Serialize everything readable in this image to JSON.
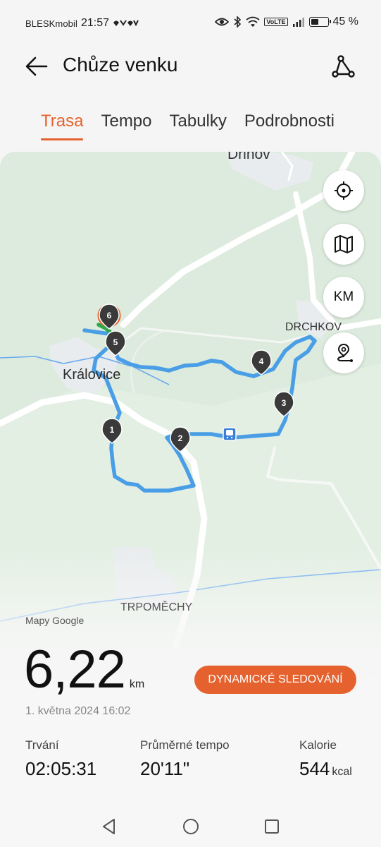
{
  "status": {
    "carrier": "BLESKmobil",
    "time": "21:57",
    "volte": "VoLTE",
    "battery": "45 %"
  },
  "header": {
    "title": "Chůze venku"
  },
  "tabs": [
    {
      "label": "Trasa",
      "active": true
    },
    {
      "label": "Tempo",
      "active": false
    },
    {
      "label": "Tabulky",
      "active": false
    },
    {
      "label": "Podrobnosti",
      "active": false
    }
  ],
  "map": {
    "places": {
      "drinov": "Drinov",
      "kralovice": "Královice",
      "drchkov": "DRCHKOV",
      "trpomechy": "TRPOMĚCHY"
    },
    "controls": {
      "km_label": "KM"
    },
    "markers": [
      "1",
      "2",
      "3",
      "4",
      "5",
      "6"
    ],
    "attribution": "Mapy Google",
    "route_color": "#4a9ee6"
  },
  "summary": {
    "distance": "6,22",
    "distance_unit": "km",
    "live_tracking_label": "DYNAMICKÉ SLEDOVÁNÍ",
    "date": "1. května 2024 16:02",
    "stats": {
      "duration": {
        "label": "Trvání",
        "value": "02:05:31"
      },
      "pace": {
        "label": "Průměrné tempo",
        "value": "20'11\""
      },
      "calories": {
        "label": "Kalorie",
        "value": "544",
        "unit": "kcal"
      }
    }
  },
  "colors": {
    "accent": "#e5622e",
    "map_green": "#dcebdd",
    "water": "#6aaaf0"
  }
}
